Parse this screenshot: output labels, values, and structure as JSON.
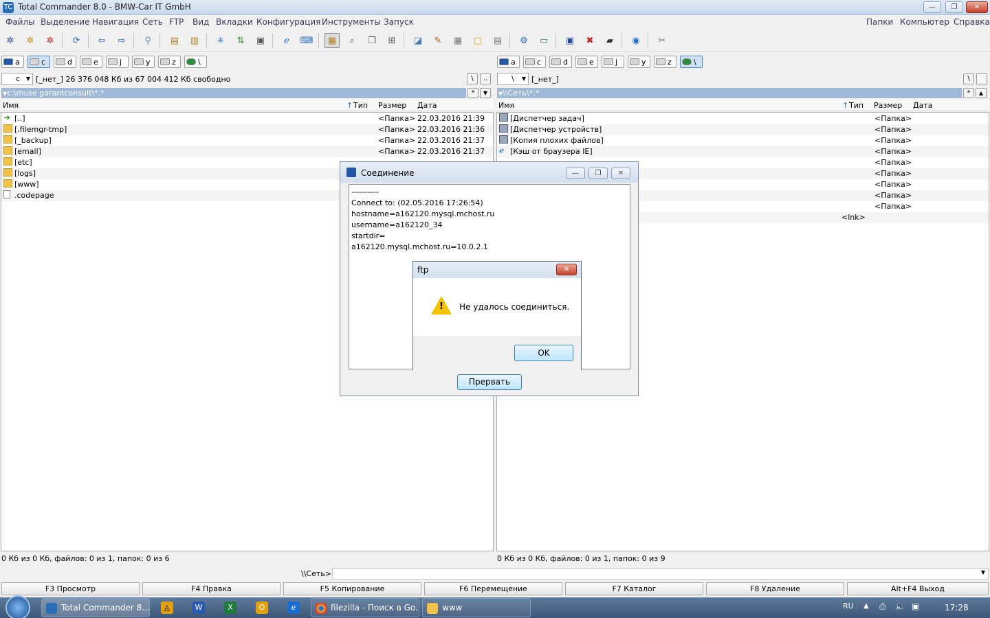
{
  "window": {
    "title": "Total Commander 8.0 - BMW-Car IT GmbH",
    "min": "—",
    "max": "❐",
    "close": "✕"
  },
  "menu": {
    "left": [
      "Файлы",
      "Выделение",
      "Навигация",
      "Сеть",
      "FTP",
      "Вид",
      "Вкладки",
      "Конфигурация",
      "Инструменты",
      "Запуск"
    ],
    "right": [
      "Папки",
      "Компьютер",
      "Справка"
    ]
  },
  "toolbar": {
    "icons": [
      "settings-icon",
      "gear-icon",
      "gear-red-icon",
      "refresh-icon",
      "back-icon",
      "forward-icon",
      "network-search-icon",
      "pack-icon",
      "unpack-icon",
      "ftp-icon",
      "sync-icon",
      "clipboard-icon",
      "ie-icon",
      "network-icon",
      "file-view-icon",
      "find-icon",
      "copy-names-icon",
      "compare-icon",
      "disk-icon",
      "brush-icon",
      "calculator-icon",
      "notes-icon",
      "notepad-icon",
      "share-icon",
      "drive-icon",
      "monitor-icon",
      "remove-icon",
      "terminal-icon",
      "browser-icon",
      "cleanup-icon"
    ]
  },
  "left": {
    "drives": [
      "a",
      "c",
      "d",
      "e",
      "j",
      "y",
      "z",
      "\\"
    ],
    "drive_select": "c",
    "drive_info": "[_нет_]  26 376 048 Кб из 67 004 412 Кб свободно",
    "path": "c:\\muse garantconsult\\*.*",
    "btn_root": "\\",
    "btn_up": "..",
    "filter_star": "*",
    "filter_arrow": "▼",
    "headers": {
      "name": "Имя",
      "type": "Тип",
      "size": "Размер",
      "date": "Дата"
    },
    "sort_arrow": "↑",
    "files": [
      {
        "name": "[..]",
        "icon": "up",
        "size": "<Папка>",
        "date": "22.03.2016 21:39"
      },
      {
        "name": "[.filemgr-tmp]",
        "icon": "folder",
        "size": "<Папка>",
        "date": "22.03.2016 21:36"
      },
      {
        "name": "[_backup]",
        "icon": "folder",
        "size": "<Папка>",
        "date": "22.03.2016 21:37"
      },
      {
        "name": "[email]",
        "icon": "folder",
        "size": "<Папка>",
        "date": "22.03.2016 21:37"
      },
      {
        "name": "[etc]",
        "icon": "folder",
        "size": "",
        "date": ""
      },
      {
        "name": "[logs]",
        "icon": "folder",
        "size": "",
        "date": ""
      },
      {
        "name": "[www]",
        "icon": "folder",
        "size": "",
        "date": ""
      },
      {
        "name": ".codepage",
        "icon": "file",
        "size": "",
        "date": ""
      }
    ],
    "status": "0 Кб из 0 Кб, файлов: 0 из 1, папок: 0 из 6"
  },
  "right": {
    "drives": [
      "a",
      "c",
      "d",
      "e",
      "j",
      "y",
      "z",
      "\\"
    ],
    "drive_select": "\\",
    "drive_info": "[_нет_]",
    "path": "\\\\Сеть\\*.*",
    "btn_root": "\\",
    "filter_star": "*",
    "filter_arrow": "▲",
    "headers": {
      "name": "Имя",
      "type": "Тип",
      "size": "Размер",
      "date": "Дата"
    },
    "sort_arrow": "↑",
    "files": [
      {
        "name": "[Диспетчер задач]",
        "size": "<Папка>"
      },
      {
        "name": "[Диспетчер устройств]",
        "size": "<Папка>"
      },
      {
        "name": "[Копия плохих файлов]",
        "size": "<Папка>"
      },
      {
        "name": "[Кэш от браузера IE]",
        "size": "<Папка>"
      },
      {
        "name": "",
        "size": "<Папка>"
      },
      {
        "name": "",
        "size": "<Папка>"
      },
      {
        "name": "",
        "size": "<Папка>"
      },
      {
        "name": "",
        "size": "<Папка>"
      },
      {
        "name": "",
        "size": "<Папка>"
      },
      {
        "name": "",
        "size": "<lnk>"
      }
    ],
    "status": "0 Кб из 0 Кб, файлов: 0 из 1, папок: 0 из 9"
  },
  "cmdline": {
    "prompt": "\\\\Сеть>",
    "arrow": "▼"
  },
  "fkeys": [
    "F3 Просмотр",
    "F4 Правка",
    "F5 Копирование",
    "F6 Перемещение",
    "F7 Каталог",
    "F8 Удаление",
    "Alt+F4 Выход"
  ],
  "connect_dialog": {
    "title": "Соединение",
    "log": [
      "----------",
      "Connect to: (02.05.2016 17:26:54)",
      "hostname=a162120.mysql.mchost.ru",
      "username=a162120_34",
      "startdir=",
      "a162120.mysql.mchost.ru=10.0.2.1"
    ],
    "abort": "Прервать"
  },
  "ftp_dialog": {
    "title": "ftp",
    "message": "Не удалось соединиться.",
    "ok": "OK",
    "close": "✕"
  },
  "taskbar": {
    "tasks": [
      {
        "label": "Total Commander 8....",
        "color": "#2a6cb8"
      },
      {
        "label": "filezilla - Поиск в Go...",
        "color": "#e8b830"
      },
      {
        "label": "www",
        "color": "#f0c24a"
      }
    ],
    "lang": "RU",
    "time": "17:28"
  }
}
